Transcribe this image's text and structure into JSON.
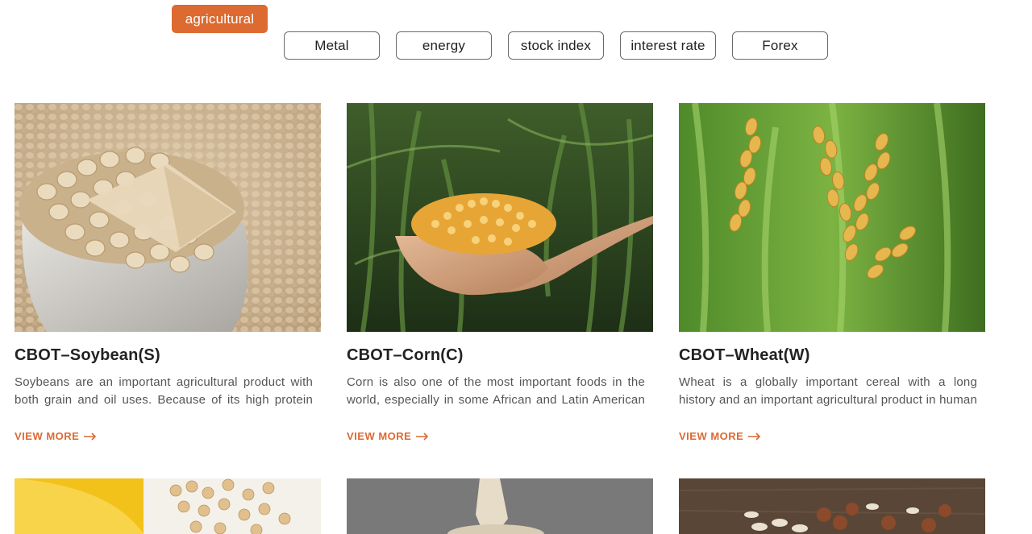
{
  "tabs": [
    {
      "label": "agricultural",
      "active": true
    },
    {
      "label": "Metal",
      "active": false
    },
    {
      "label": "energy",
      "active": false
    },
    {
      "label": "stock index",
      "active": false
    },
    {
      "label": "interest rate",
      "active": false
    },
    {
      "label": "Forex",
      "active": false
    }
  ],
  "accent_color": "#dc6a31",
  "cards": [
    {
      "title": "CBOT–Soybean(S)",
      "description": "Soybeans are an important agricultural product with both grain and oil uses. Because of its high protein and oil",
      "more_label": "VIEW MORE",
      "image": "soybeans-in-sack"
    },
    {
      "title": "CBOT–Corn(C)",
      "description": "Corn is also one of the most important foods in the world, especially in some African and Latin American countries.",
      "more_label": "VIEW MORE",
      "image": "corn-kernels-in-hands"
    },
    {
      "title": "CBOT–Wheat(W)",
      "description": "Wheat is a globally important cereal with a long history and an important agricultural product in human history. The",
      "more_label": "VIEW MORE",
      "image": "wheat-ears-in-field"
    }
  ],
  "bottom_cards": [
    {
      "image": "soybean-oil-and-beans"
    },
    {
      "image": "flour-pouring"
    },
    {
      "image": "mixed-nuts-on-wood"
    }
  ]
}
